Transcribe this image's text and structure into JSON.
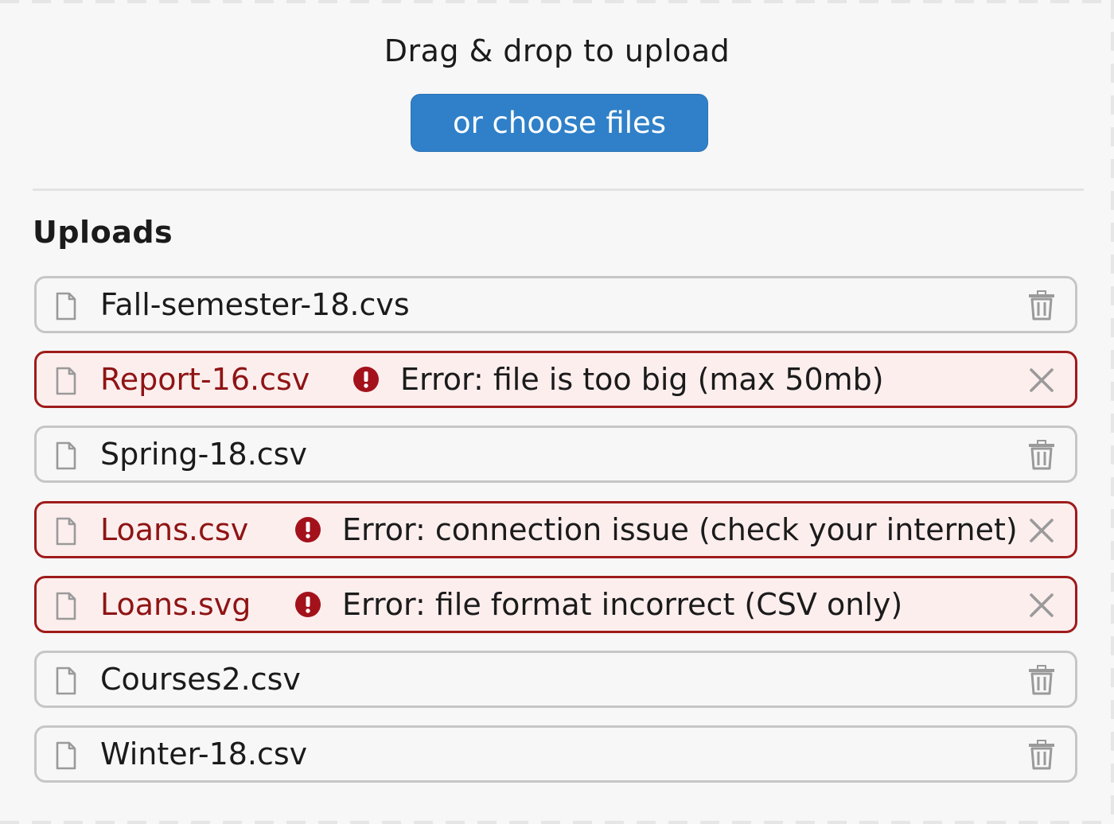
{
  "dropzone": {
    "title": "Drag & drop to upload",
    "choose_label": "or choose files"
  },
  "uploads": {
    "title": "Uploads",
    "files": [
      {
        "name": "Fall-semester-18.cvs",
        "status": "ok",
        "icon": "file-icon",
        "action_icon": "trash-icon"
      },
      {
        "name": "Report-16.csv",
        "status": "error",
        "error": "Error: file is too big (max 50mb)",
        "icon": "file-icon",
        "error_icon": "alert-circle-icon",
        "action_icon": "close-icon"
      },
      {
        "name": "Spring-18.csv",
        "status": "ok",
        "icon": "file-icon",
        "action_icon": "trash-icon"
      },
      {
        "name": "Loans.csv",
        "status": "error",
        "error": "Error: connection issue (check your internet)",
        "icon": "file-icon",
        "error_icon": "alert-circle-icon",
        "action_icon": "close-icon"
      },
      {
        "name": "Loans.svg",
        "status": "error",
        "error": "Error: file format incorrect (CSV only)",
        "icon": "file-icon",
        "error_icon": "alert-circle-icon",
        "action_icon": "close-icon"
      },
      {
        "name": "Courses2.csv",
        "status": "ok",
        "icon": "file-icon",
        "action_icon": "trash-icon"
      },
      {
        "name": "Winter-18.csv",
        "status": "ok",
        "icon": "file-icon",
        "action_icon": "trash-icon"
      }
    ]
  },
  "colors": {
    "accent": "#2f80c8",
    "error": "#9e1b1b",
    "error_bg": "#fdeeee",
    "border": "#c6c6c6",
    "background": "#f7f7f7"
  }
}
